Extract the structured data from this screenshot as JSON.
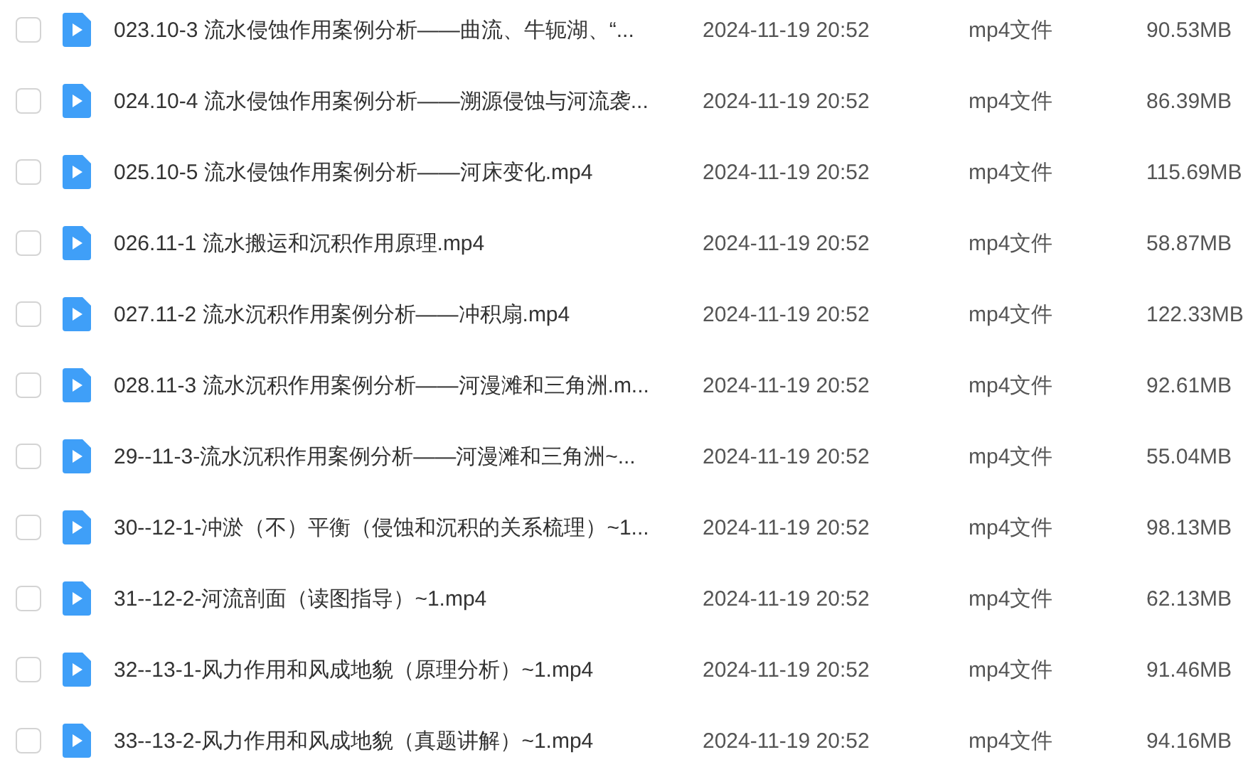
{
  "files": [
    {
      "checked": false,
      "name": "023.10-3 流水侵蚀作用案例分析——曲流、牛轭湖、“...",
      "modified": "2024-11-19 20:52",
      "type": "mp4文件",
      "size": "90.53MB"
    },
    {
      "checked": false,
      "name": "024.10-4 流水侵蚀作用案例分析——溯源侵蚀与河流袭...",
      "modified": "2024-11-19 20:52",
      "type": "mp4文件",
      "size": "86.39MB"
    },
    {
      "checked": false,
      "name": "025.10-5 流水侵蚀作用案例分析——河床变化.mp4",
      "modified": "2024-11-19 20:52",
      "type": "mp4文件",
      "size": "115.69MB"
    },
    {
      "checked": false,
      "name": "026.11-1 流水搬运和沉积作用原理.mp4",
      "modified": "2024-11-19 20:52",
      "type": "mp4文件",
      "size": "58.87MB"
    },
    {
      "checked": false,
      "name": "027.11-2 流水沉积作用案例分析——冲积扇.mp4",
      "modified": "2024-11-19 20:52",
      "type": "mp4文件",
      "size": "122.33MB"
    },
    {
      "checked": false,
      "name": "028.11-3 流水沉积作用案例分析——河漫滩和三角洲.m...",
      "modified": "2024-11-19 20:52",
      "type": "mp4文件",
      "size": "92.61MB"
    },
    {
      "checked": false,
      "name": "29--11-3-流水沉积作用案例分析——河漫滩和三角洲~...",
      "modified": "2024-11-19 20:52",
      "type": "mp4文件",
      "size": "55.04MB"
    },
    {
      "checked": false,
      "name": "30--12-1-冲淤（不）平衡（侵蚀和沉积的关系梳理）~1...",
      "modified": "2024-11-19 20:52",
      "type": "mp4文件",
      "size": "98.13MB"
    },
    {
      "checked": false,
      "name": "31--12-2-河流剖面（读图指导）~1.mp4",
      "modified": "2024-11-19 20:52",
      "type": "mp4文件",
      "size": "62.13MB"
    },
    {
      "checked": false,
      "name": "32--13-1-风力作用和风成地貌（原理分析）~1.mp4",
      "modified": "2024-11-19 20:52",
      "type": "mp4文件",
      "size": "91.46MB"
    },
    {
      "checked": false,
      "name": "33--13-2-风力作用和风成地貌（真题讲解）~1.mp4",
      "modified": "2024-11-19 20:52",
      "type": "mp4文件",
      "size": "94.16MB"
    }
  ]
}
